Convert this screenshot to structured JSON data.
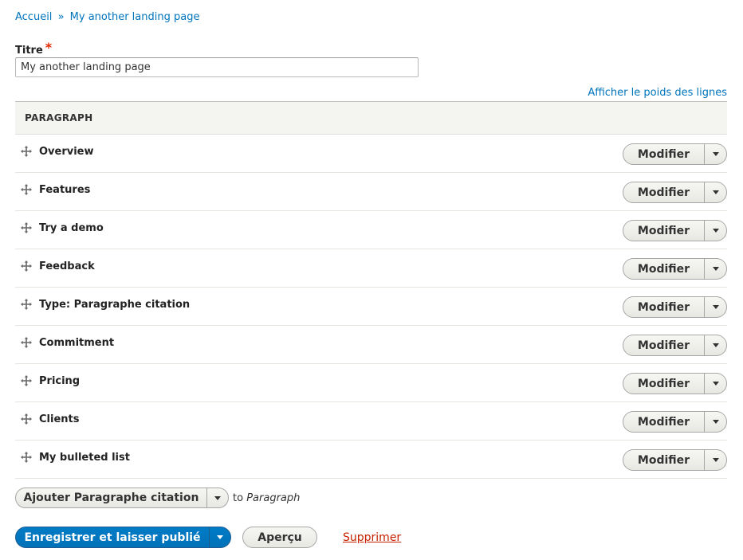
{
  "breadcrumb": {
    "home": "Accueil",
    "separator": "»",
    "current": "My another landing page"
  },
  "title_field": {
    "label": "Titre",
    "required_marker": "*",
    "value": "My another landing page"
  },
  "show_weights_link": "Afficher le poids des lignes",
  "table": {
    "header": "PARAGRAPH",
    "edit_label": "Modifier",
    "rows": [
      {
        "label": "Overview"
      },
      {
        "label": "Features"
      },
      {
        "label": "Try a demo"
      },
      {
        "label": "Feedback"
      },
      {
        "label": "Type: Paragraphe citation"
      },
      {
        "label": "Commitment"
      },
      {
        "label": "Pricing"
      },
      {
        "label": "Clients"
      },
      {
        "label": "My bulleted list"
      }
    ]
  },
  "add": {
    "button_label": "Ajouter Paragraphe citation",
    "to_prefix": "to",
    "to_target": "Paragraph"
  },
  "actions": {
    "save_label": "Enregistrer et laisser publié",
    "preview_label": "Aperçu",
    "delete_label": "Supprimer"
  },
  "colors": {
    "link": "#0074bd",
    "primary": "#0074bd",
    "danger": "#c72100",
    "required": "#e32700"
  }
}
